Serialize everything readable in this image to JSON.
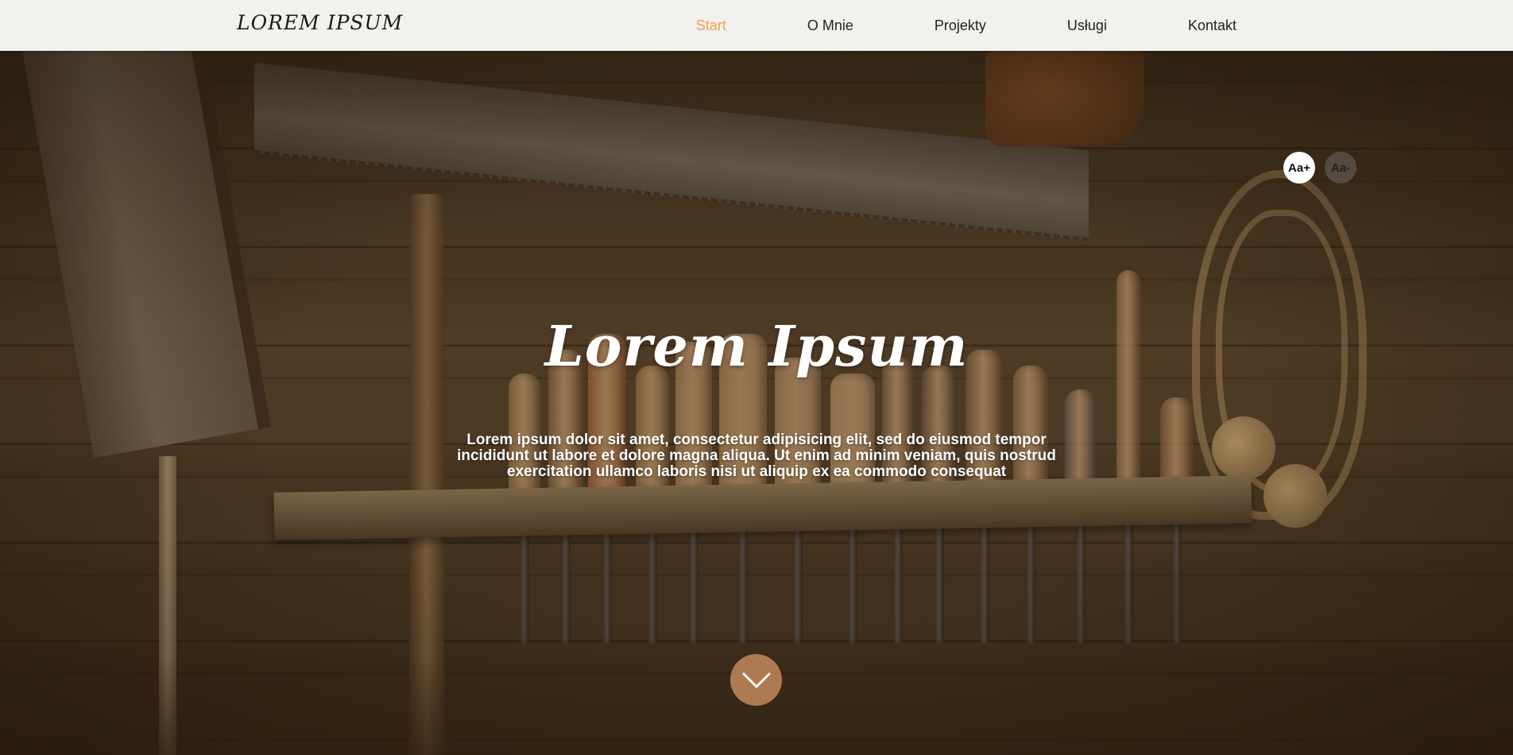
{
  "logo": "LOREM IPSUM",
  "nav": {
    "items": [
      {
        "label": "Start",
        "active": true
      },
      {
        "label": "O Mnie",
        "active": false
      },
      {
        "label": "Projekty",
        "active": false
      },
      {
        "label": "Usługi",
        "active": false
      },
      {
        "label": "Kontakt",
        "active": false
      }
    ]
  },
  "font_controls": {
    "increase_label": "Aa+",
    "decrease_label": "Aa-"
  },
  "hero": {
    "title": "Lorem Ipsum",
    "text": "Lorem ipsum dolor sit amet, consectetur adipisicing elit, sed do eiusmod tempor incididunt ut labore et dolore magna aliqua. Ut enim ad minim veniam, quis nostrud exercitation ullamco laboris nisi ut aliquip ex ea commodo consequat",
    "scroll_icon": "chevron-down-icon"
  },
  "colors": {
    "nav_background": "#f3f1ee",
    "nav_active": "#f0a14a",
    "scroll_button": "#d69664"
  }
}
